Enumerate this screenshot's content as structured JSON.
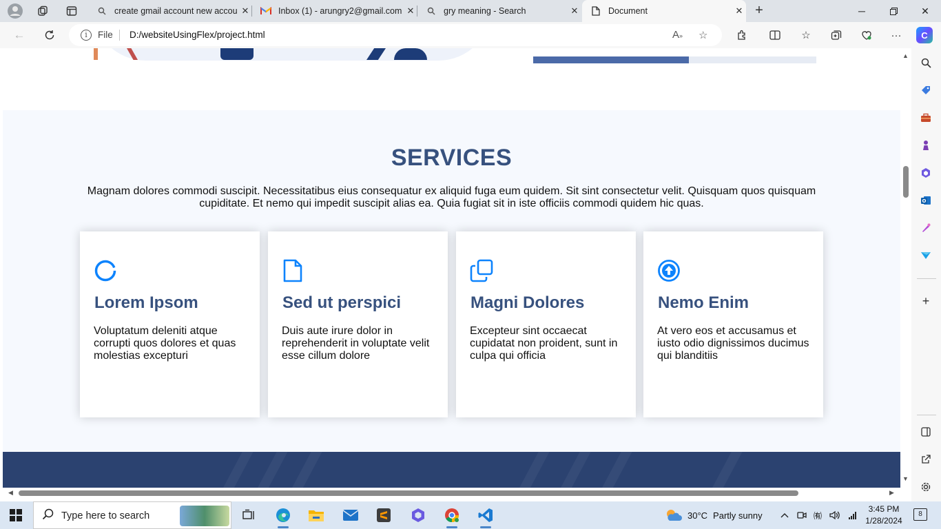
{
  "browser": {
    "tabs": [
      {
        "title": "create gmail account new accou",
        "favicon": "search-icon"
      },
      {
        "title": "Inbox (1) - arungry2@gmail.com",
        "favicon": "gmail-icon"
      },
      {
        "title": "gry meaning - Search",
        "favicon": "search-icon"
      },
      {
        "title": "Document",
        "favicon": "document-icon",
        "active": true
      }
    ],
    "address": {
      "scheme_label": "File",
      "url": "D:/websiteUsingFlex/project.html"
    }
  },
  "page": {
    "hero": {
      "progress_fraction": 0.55
    },
    "services": {
      "title": "SERVICES",
      "description": "Magnam dolores commodi suscipit. Necessitatibus eius consequatur ex aliquid fuga eum quidem. Sit sint consectetur velit. Quisquam quos quisquam cupiditate. Et nemo qui impedit suscipit alias ea. Quia fugiat sit in iste officiis commodi quidem hic quas.",
      "cards": [
        {
          "icon": "circle-icon",
          "title": "Lorem Ipsom",
          "text": "Voluptatum deleniti atque corrupti quos dolores et quas molestias excepturi"
        },
        {
          "icon": "file-icon",
          "title": "Sed ut perspici",
          "text": "Duis aute irure dolor in reprehenderit in voluptate velit esse cillum dolore"
        },
        {
          "icon": "copy-icon",
          "title": "Magni Dolores",
          "text": "Excepteur sint occaecat cupidatat non proident, sunt in culpa qui officia"
        },
        {
          "icon": "arrow-up-circle-icon",
          "title": "Nemo Enim",
          "text": "At vero eos et accusamus et iusto odio dignissimos ducimus qui blanditiis"
        }
      ],
      "accent_color": "#37517e",
      "icon_color": "#0d83fd"
    }
  },
  "taskbar": {
    "search_placeholder": "Type here to search",
    "weather": {
      "temp": "30°C",
      "condition": "Partly sunny"
    },
    "time": "3:45 PM",
    "date": "1/28/2024",
    "notification_count": "8"
  }
}
